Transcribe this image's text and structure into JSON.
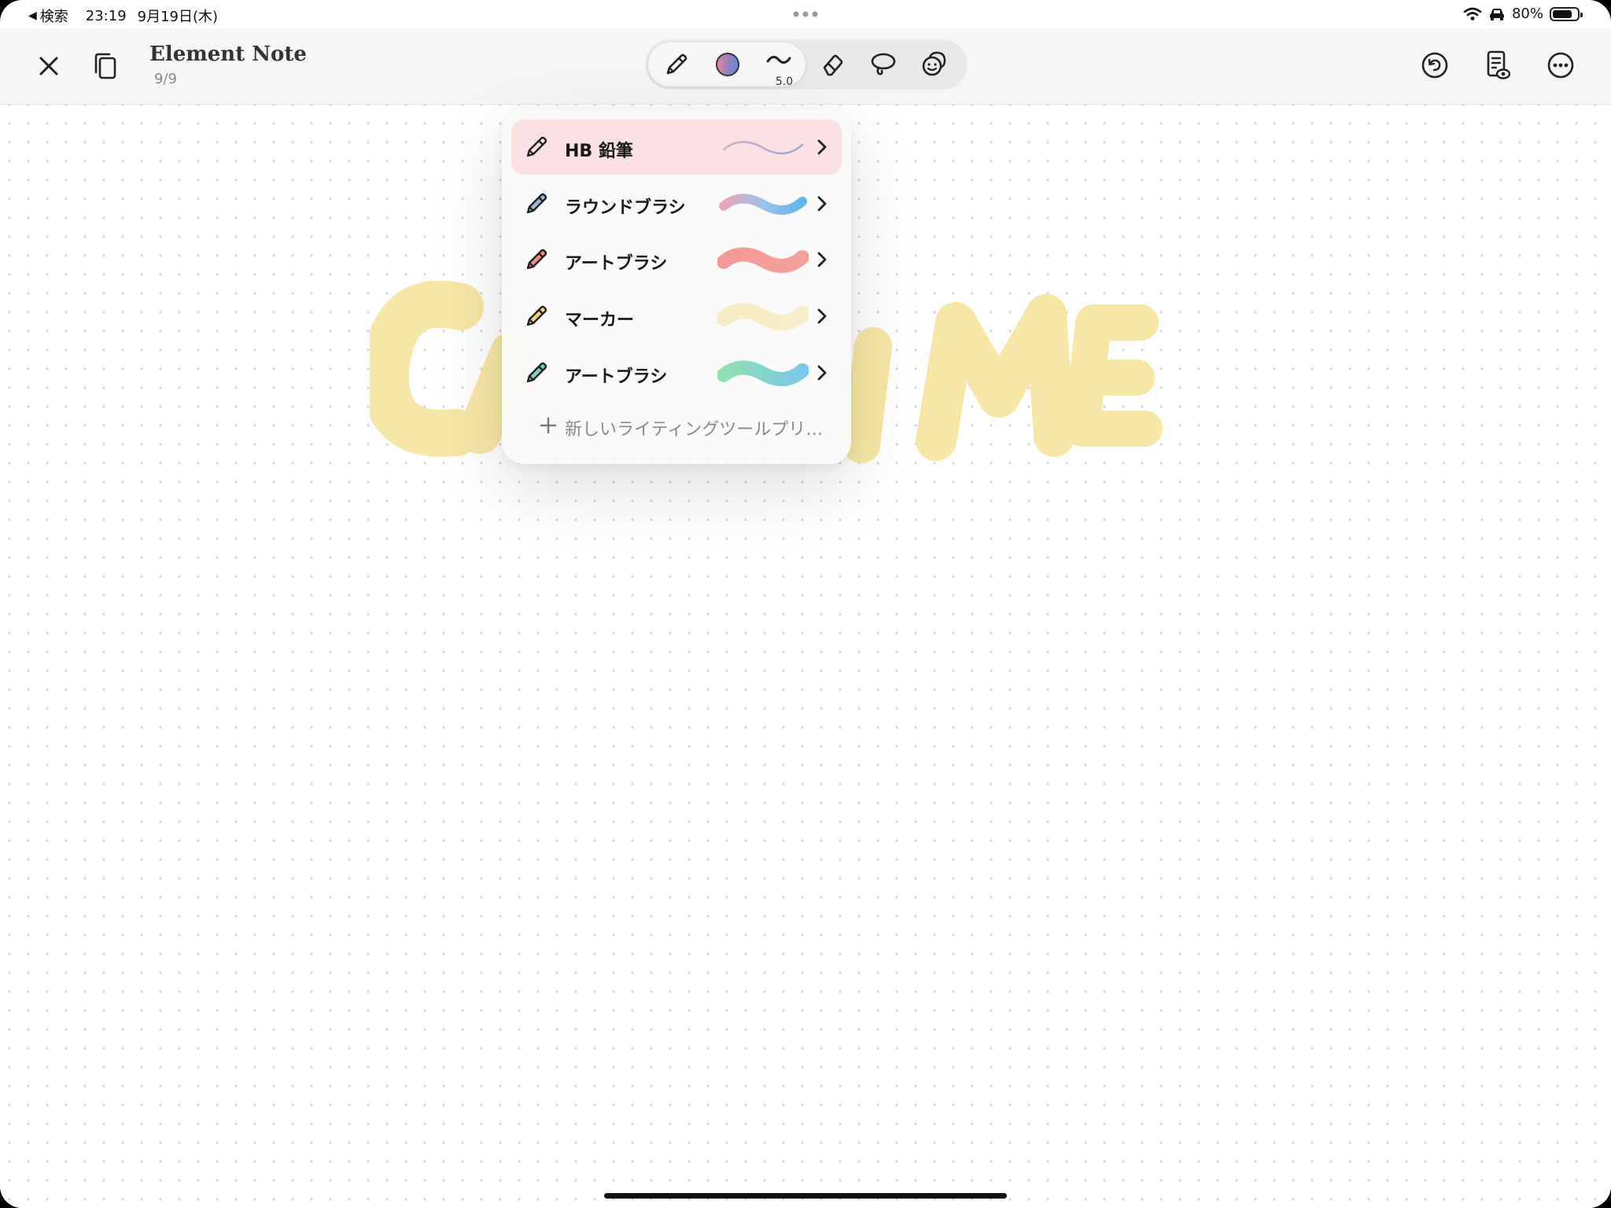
{
  "status": {
    "back_label": "検索",
    "time": "23:19",
    "date": "9月19日(木)",
    "battery": "80%",
    "battery_level": 0.8
  },
  "header": {
    "title": "Element Note",
    "pages": "9/9",
    "pen_size": "5.0"
  },
  "menu": {
    "items": [
      {
        "label": "HB 鉛筆",
        "selected": true,
        "tip_color": "#444444"
      },
      {
        "label": "ラウンドブラシ",
        "selected": false,
        "tip_color": "#9ab6db"
      },
      {
        "label": "アートブラシ",
        "selected": false,
        "tip_color": "#f08c8c"
      },
      {
        "label": "マーカー",
        "selected": false,
        "tip_color": "#f2d27a"
      },
      {
        "label": "アートブラシ",
        "selected": false,
        "tip_color": "#7fd0c0"
      }
    ],
    "add_label": "新しいライティングツールプリ…"
  },
  "colors": {
    "accent_selected": "#fbe1e3",
    "background_text": "#f7e7a6"
  }
}
